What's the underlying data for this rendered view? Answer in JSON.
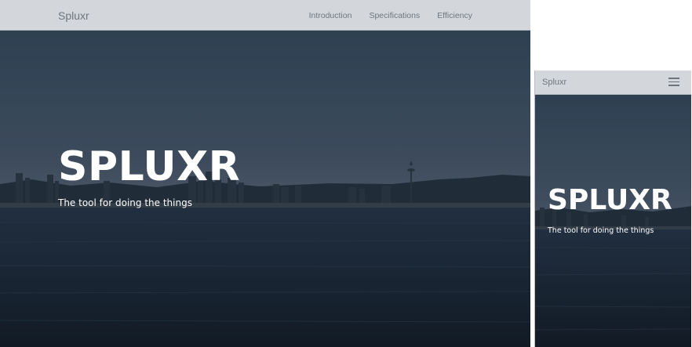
{
  "desktop": {
    "brand": "Spluxr",
    "nav_links": [
      "Introduction",
      "Specifications",
      "Efficiency"
    ],
    "hero": {
      "title": "SPLUXR",
      "subtitle": "The tool for doing the things"
    }
  },
  "mobile": {
    "brand": "Spluxr",
    "menu_icon": "hamburger-menu-icon",
    "hero": {
      "title": "SPLUXR",
      "subtitle": "The tool for doing the things"
    }
  },
  "colors": {
    "navbar_bg": "#d3d7dc",
    "nav_text": "#6e757c",
    "sky_top": "#344a5d",
    "sky_horizon": "#4f5f70",
    "water": "#1b2838",
    "hero_text": "#ffffff"
  }
}
